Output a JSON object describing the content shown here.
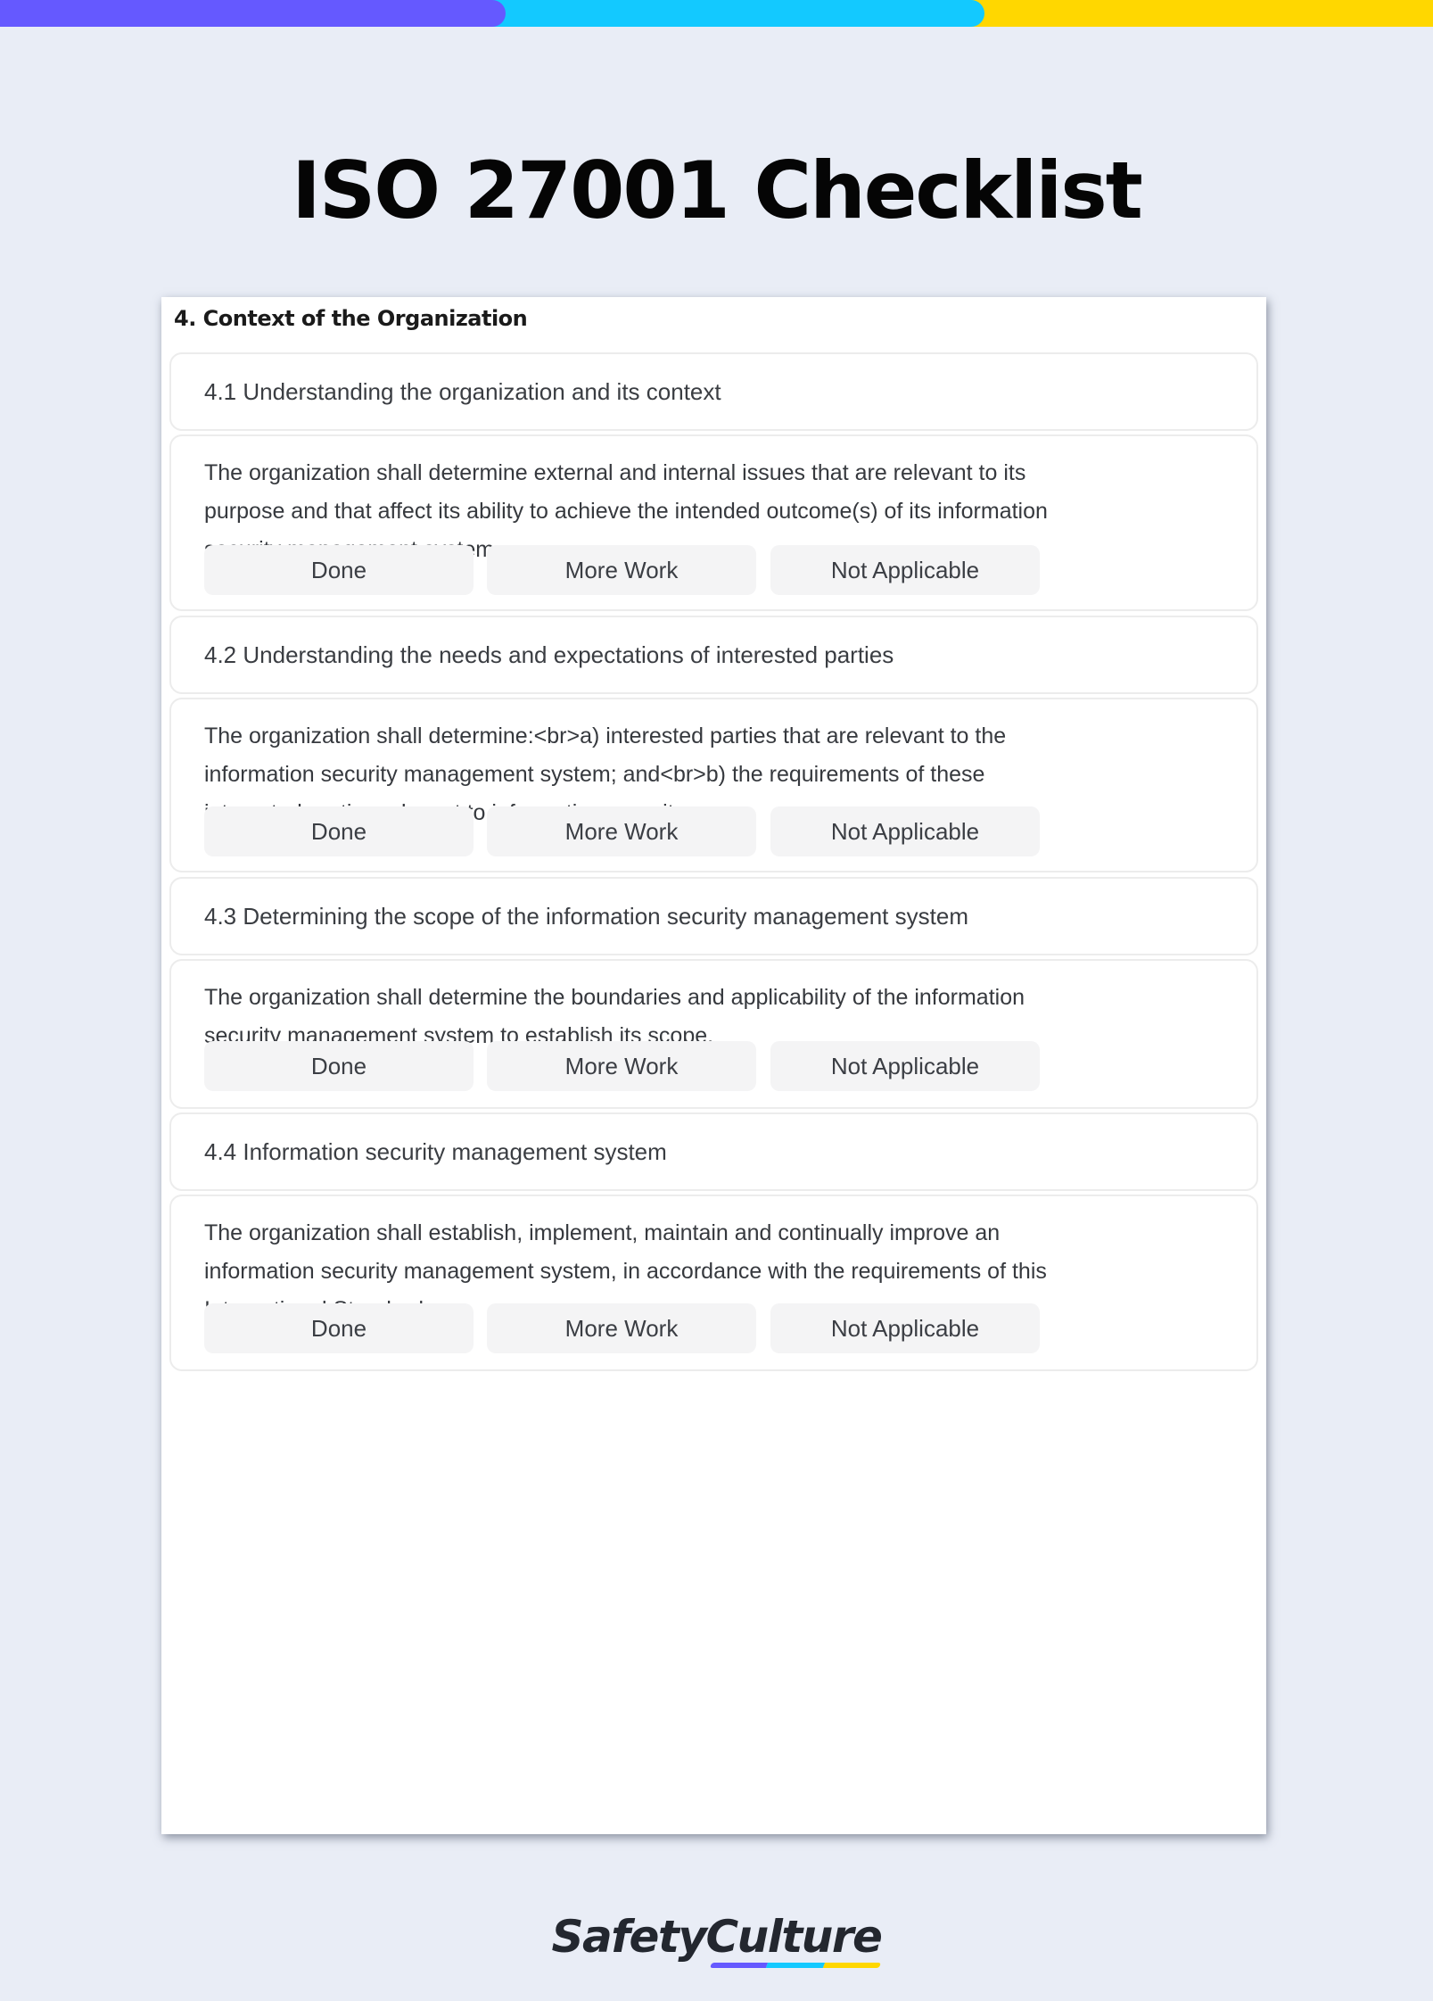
{
  "colors": {
    "stripe_purple": "#6559FF",
    "stripe_cyan": "#13C9FF",
    "stripe_yellow": "#FFD700",
    "background": "#E9EDF6"
  },
  "page_title": "ISO 27001 Checklist",
  "card": {
    "section_heading": "4. Context of the Organization",
    "items": [
      {
        "title": "4.1 Understanding the organization and its context",
        "description": "The organization shall determine external and internal issues that are relevant to its purpose and that affect its ability to achieve the intended outcome(s) of its information security management system.",
        "buttons": [
          "Done",
          "More Work",
          "Not Applicable"
        ]
      },
      {
        "title": "4.2 Understanding the needs and expectations of interested parties",
        "description": "The organization shall determine:<br>a) interested parties that are relevant to the information security management system; and<br>b) the requirements of these interested parties relevant to information security",
        "buttons": [
          "Done",
          "More Work",
          "Not Applicable"
        ]
      },
      {
        "title": "4.3 Determining the scope of the information security management system",
        "description": "The organization shall determine the boundaries and applicability of the information security management system to establish its scope.",
        "buttons": [
          "Done",
          "More Work",
          "Not Applicable"
        ]
      },
      {
        "title": "4.4 Information security management system",
        "description": "The organization shall establish, implement, maintain and continually improve an information security management system, in accordance with the requirements of this International Standard.",
        "buttons": [
          "Done",
          "More Work",
          "Not Applicable"
        ]
      }
    ]
  },
  "footer": {
    "brand": "SafetyCulture"
  }
}
